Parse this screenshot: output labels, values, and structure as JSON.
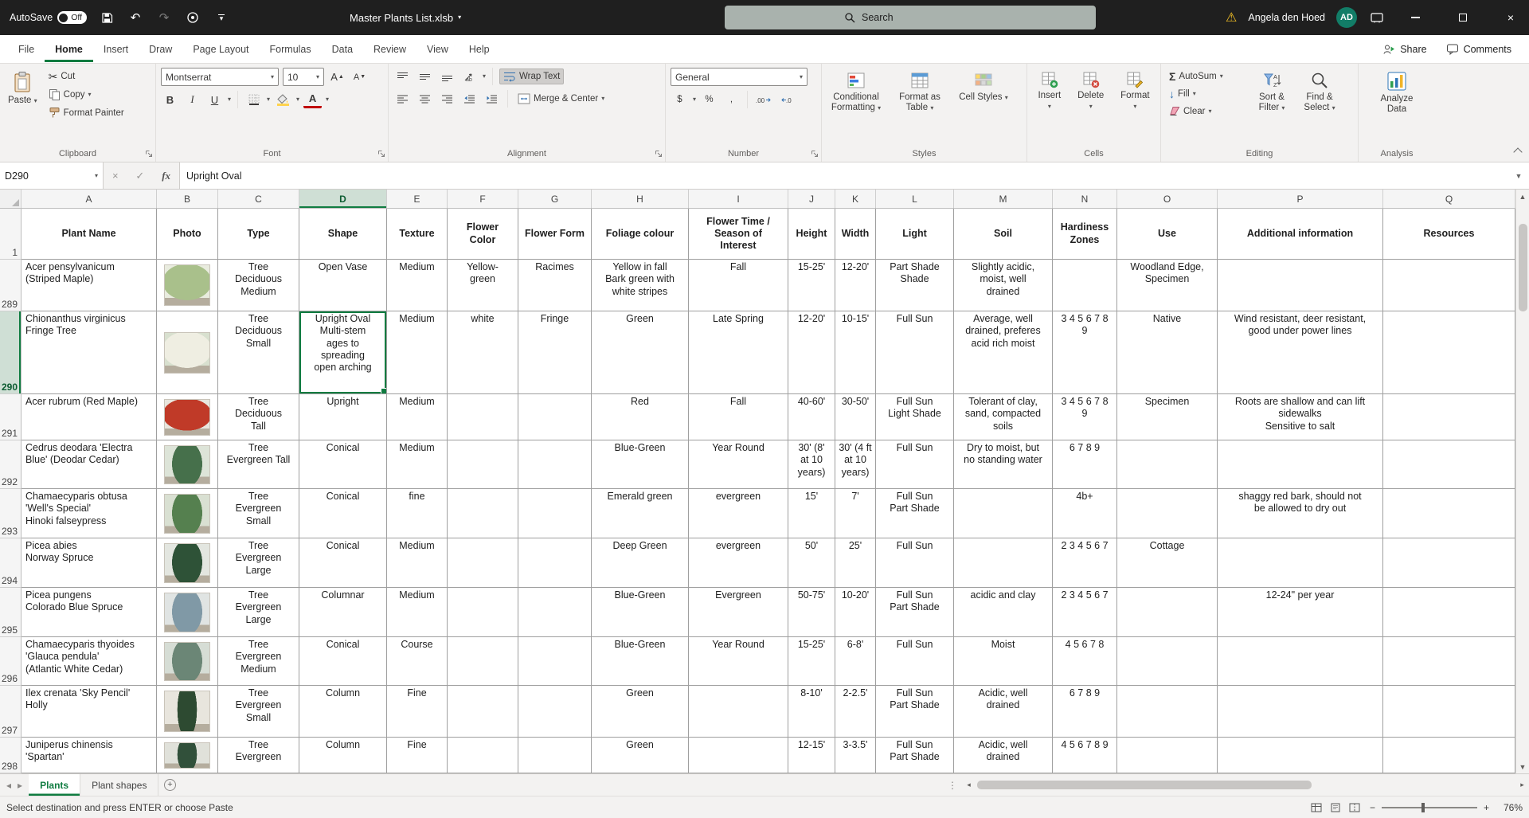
{
  "titlebar": {
    "autosave_label": "AutoSave",
    "autosave_state": "Off",
    "doc_title": "Master Plants List.xlsb",
    "search_text": "Search",
    "user_name": "Angela den Hoed",
    "user_initials": "AD"
  },
  "ribbon_tabs": {
    "items": [
      "File",
      "Home",
      "Insert",
      "Draw",
      "Page Layout",
      "Formulas",
      "Data",
      "Review",
      "View",
      "Help"
    ],
    "active": "Home",
    "share_label": "Share",
    "comments_label": "Comments"
  },
  "ribbon": {
    "clipboard": {
      "group_label": "Clipboard",
      "paste": "Paste",
      "cut": "Cut",
      "copy": "Copy",
      "format_painter": "Format Painter"
    },
    "font": {
      "group_label": "Font",
      "font_name": "Montserrat",
      "font_size": "10"
    },
    "alignment": {
      "group_label": "Alignment",
      "wrap_text": "Wrap Text",
      "merge_center": "Merge & Center"
    },
    "number": {
      "group_label": "Number",
      "format": "General"
    },
    "styles": {
      "group_label": "Styles",
      "conditional": "Conditional Formatting",
      "format_table": "Format as Table",
      "cell_styles": "Cell Styles"
    },
    "cells": {
      "group_label": "Cells",
      "insert": "Insert",
      "delete": "Delete",
      "format": "Format"
    },
    "editing": {
      "group_label": "Editing",
      "autosum": "AutoSum",
      "fill": "Fill",
      "clear": "Clear",
      "sort_filter": "Sort & Filter",
      "find_select": "Find & Select"
    },
    "analysis": {
      "group_label": "Analysis",
      "analyze": "Analyze Data"
    }
  },
  "formula_bar": {
    "name_box": "D290",
    "fx": "fx",
    "content": "Upright Oval"
  },
  "icons": {
    "cut": "✂",
    "autosum": "Σ",
    "undo": "↶",
    "redo": "↷",
    "warning": "⚠",
    "check": "✓",
    "cancel": "×",
    "bold": "B",
    "italic": "I",
    "underline": "U",
    "dollar": "$",
    "percent": "%",
    "comma": ",",
    "fill_down": "↓",
    "chevron": "▾",
    "up_arrow": "▴",
    "down_arrow": "▾",
    "left_nav": "◂",
    "right_nav": "▸",
    "dots": "⋮",
    "minus": "−",
    "plus": "+"
  },
  "sheet": {
    "columns": [
      "A",
      "B",
      "C",
      "D",
      "E",
      "F",
      "G",
      "H",
      "I",
      "J",
      "K",
      "L",
      "M",
      "N",
      "O",
      "P",
      "Q"
    ],
    "active_cell": "D290",
    "header_row": {
      "num": "1",
      "cells": [
        "Plant Name",
        "Photo",
        "Type",
        "Shape",
        "Texture",
        "Flower\nColor",
        "Flower Form",
        "Foliage colour",
        "Flower Time /\nSeason of\nInterest",
        "Height",
        "Width",
        "Light",
        "Soil",
        "Hardiness\nZones",
        "Use",
        "Additional information",
        "Resources"
      ]
    },
    "rows": [
      {
        "num": "289",
        "photo": {
          "bg": "#e9ecdf",
          "fg": "#a9c08b",
          "shape": "broad"
        },
        "cells": [
          "Acer pensylvanicum\n(Striped Maple)",
          "",
          "Tree\nDeciduous\nMedium",
          "Open Vase",
          "Medium",
          "Yellow-\ngreen",
          "Racimes",
          "Yellow in fall\nBark green with\nwhite stripes",
          "Fall",
          "15-25'",
          "12-20'",
          "Part Shade\nShade",
          "Slightly acidic,\nmoist, well\ndrained",
          "",
          "Woodland Edge,\nSpecimen",
          "",
          ""
        ]
      },
      {
        "num": "290",
        "photo": {
          "bg": "#d8e0cf",
          "fg": "#efeee2",
          "shape": "broad"
        },
        "cells": [
          "Chionanthus virginicus\nFringe Tree",
          "",
          "Tree\nDeciduous\nSmall",
          "Upright Oval\nMulti-stem\nages to\nspreading\nopen arching",
          "Medium",
          "white",
          "Fringe",
          "Green",
          "Late Spring",
          "12-20'",
          "10-15'",
          "Full Sun",
          "Average, well\ndrained, preferes\nacid rich moist",
          "3 4 5 6 7 8\n9",
          "Native",
          "Wind resistant, deer resistant,\ngood under power lines",
          ""
        ]
      },
      {
        "num": "291",
        "photo": {
          "bg": "#e8e6de",
          "fg": "#c03a28",
          "shape": "broad"
        },
        "cells": [
          "Acer rubrum (Red Maple)",
          "",
          "Tree\nDeciduous\nTall",
          "Upright",
          "Medium",
          "",
          "",
          "Red",
          "Fall",
          "40-60'",
          "30-50'",
          "Full Sun\nLight Shade",
          "Tolerant of clay,\nsand, compacted\nsoils",
          "3 4 5 6 7 8\n9",
          "Specimen",
          "Roots are shallow and can lift\nsidewalks\nSensitive to salt",
          ""
        ]
      },
      {
        "num": "292",
        "photo": {
          "bg": "#dde4d8",
          "fg": "#46704b",
          "shape": "cone"
        },
        "cells": [
          "Cedrus deodara 'Electra\nBlue' (Deodar Cedar)",
          "",
          "Tree\nEvergreen Tall",
          "Conical",
          "Medium",
          "",
          "",
          "Blue-Green",
          "Year Round",
          "30' (8'\nat 10\nyears)",
          "30' (4 ft\nat 10\nyears)",
          "Full Sun",
          "Dry to moist, but\nno standing water",
          "6 7 8 9",
          "",
          "",
          ""
        ]
      },
      {
        "num": "293",
        "photo": {
          "bg": "#d9e0d2",
          "fg": "#55804f",
          "shape": "cone"
        },
        "cells": [
          "Chamaecyparis obtusa\n'Well's Special'\nHinoki falseypress",
          "",
          "Tree\nEvergreen\nSmall",
          "Conical",
          "fine",
          "",
          "",
          "Emerald green",
          "evergreen",
          "15'",
          "7'",
          "Full Sun\nPart Shade",
          "",
          "4b+",
          "",
          "shaggy red bark, should not\nbe allowed to dry out",
          ""
        ]
      },
      {
        "num": "294",
        "photo": {
          "bg": "#e3e6e0",
          "fg": "#2e5237",
          "shape": "cone"
        },
        "cells": [
          "Picea abies\nNorway Spruce",
          "",
          "Tree\nEvergreen\nLarge",
          "Conical",
          "Medium",
          "",
          "",
          "Deep Green",
          "evergreen",
          "50'",
          "25'",
          "Full Sun",
          "",
          "2 3 4 5 6 7",
          "Cottage",
          "",
          ""
        ]
      },
      {
        "num": "295",
        "photo": {
          "bg": "#e0e4e3",
          "fg": "#8099a6",
          "shape": "cone"
        },
        "cells": [
          "Picea pungens\nColorado Blue Spruce",
          "",
          "Tree\nEvergreen\nLarge",
          "Columnar",
          "Medium",
          "",
          "",
          "Blue-Green",
          "Evergreen",
          "50-75'",
          "10-20'",
          "Full Sun\nPart Shade",
          "acidic and clay",
          "2 3 4 5 6 7",
          "",
          "12-24\" per year",
          ""
        ]
      },
      {
        "num": "296",
        "photo": {
          "bg": "#d6ddd5",
          "fg": "#6b8676",
          "shape": "cone"
        },
        "cells": [
          "Chamaecyparis thyoides\n'Glauca pendula'\n(Atlantic White Cedar)",
          "",
          "Tree\nEvergreen\nMedium",
          "Conical",
          "Course",
          "",
          "",
          "Blue-Green",
          "Year Round",
          "15-25'",
          "6-8'",
          "Full Sun",
          "Moist",
          "4 5 6 7 8",
          "",
          "",
          ""
        ]
      },
      {
        "num": "297",
        "photo": {
          "bg": "#e8e5dd",
          "fg": "#2d4a31",
          "shape": "column"
        },
        "cells": [
          "Ilex crenata 'Sky Pencil'\nHolly",
          "",
          "Tree\nEvergreen\nSmall",
          "Column",
          "Fine",
          "",
          "",
          "Green",
          "",
          "8-10'",
          "2-2.5'",
          "Full Sun\nPart Shade",
          "Acidic, well\ndrained",
          "6 7 8 9",
          "",
          "",
          ""
        ]
      },
      {
        "num": "298",
        "photo": {
          "bg": "#e0e1da",
          "fg": "#31503a",
          "shape": "column"
        },
        "cells": [
          "Juniperus chinensis\n'Spartan'",
          "",
          "Tree\nEvergreen",
          "Column",
          "Fine",
          "",
          "",
          "Green",
          "",
          "12-15'",
          "3-3.5'",
          "Full Sun\nPart Shade",
          "Acidic, well\ndrained",
          "4 5 6 7 8 9",
          "",
          "",
          ""
        ]
      }
    ]
  },
  "tabs_bar": {
    "tabs": [
      {
        "label": "Plants"
      },
      {
        "label": "Plant shapes"
      }
    ]
  },
  "status_bar": {
    "message": "Select destination and press ENTER or choose Paste",
    "zoom": "76%"
  }
}
